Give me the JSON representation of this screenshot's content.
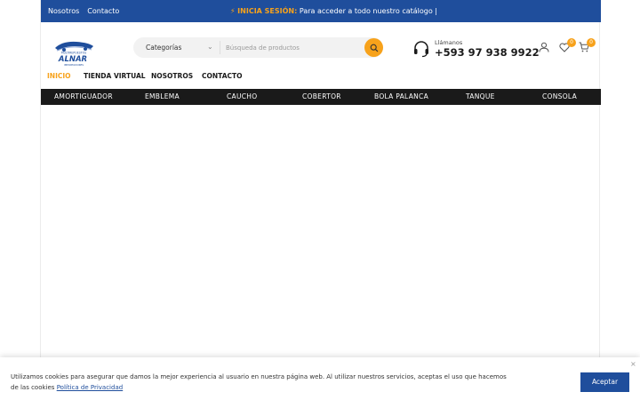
{
  "topbar": {
    "links": [
      "Nosotros",
      "Contacto"
    ],
    "promo_bolt": "⚡",
    "promo_strong": "INICIA SESIÓN:",
    "promo_text": " Para acceder a todo nuestro catálogo |"
  },
  "logo": {
    "line1": "MULTIREPUESTOS",
    "line2": "ALNAR",
    "line3": "IMPORTADORES"
  },
  "search": {
    "category_label": "Categorías",
    "placeholder": "Búsqueda de productos"
  },
  "call": {
    "label": "Llámanos",
    "number": "+593 97 938 9922"
  },
  "header_icons": {
    "wishlist_count": "0",
    "cart_count": "0"
  },
  "nav": {
    "items": [
      "INICIO",
      "TIENDA VIRTUAL",
      "NOSOTROS",
      "CONTACTO"
    ]
  },
  "categories": [
    "AMORTIGUADOR",
    "EMBLEMA",
    "CAUCHO",
    "COBERTOR",
    "BOLA PALANCA",
    "TANQUE",
    "CONSOLA"
  ],
  "cookie": {
    "text": "Utilizamos cookies para asegurar que damos la mejor experiencia al usuario en nuestra página web. Al utilizar nuestros servicios, aceptas el uso que hacemos de las cookies ",
    "link": "Política de Privacidad",
    "accept": "Aceptar",
    "close": "×"
  },
  "colors": {
    "brand_blue": "#1f4e9c",
    "accent_orange": "#f7a21b",
    "category_bar": "#1a1a1a"
  }
}
